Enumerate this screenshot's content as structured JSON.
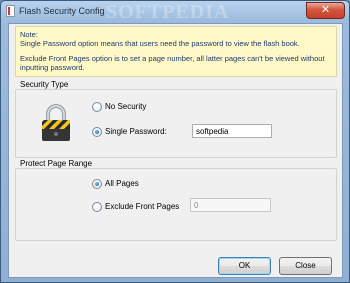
{
  "window": {
    "title": "Flash Security Config",
    "watermark": "SOFTPEDIA",
    "close_glyph": "✕"
  },
  "note": {
    "heading": "Note:",
    "line1": "Single Password option means that users need the password to view the flash book.",
    "line2": "Exclude Front Pages option is to set a page number, all latter pages can't be viewed without inputting password."
  },
  "security_type": {
    "title": "Security Type",
    "options": [
      {
        "label": "No Security",
        "checked": false
      },
      {
        "label": "Single Password:",
        "checked": true
      }
    ],
    "password_value": "softpedia",
    "icon": "padlock-icon"
  },
  "protect_range": {
    "title": "Protect Page Range",
    "options": [
      {
        "label": "All Pages",
        "checked": true
      },
      {
        "label": "Exclude Front Pages",
        "checked": false
      }
    ],
    "front_pages_value": "0"
  },
  "buttons": {
    "ok": "OK",
    "close": "Close"
  },
  "colors": {
    "note_bg": "#fff9c8",
    "note_text": "#1e3a6e",
    "title_bar": "#9cbbdd"
  }
}
